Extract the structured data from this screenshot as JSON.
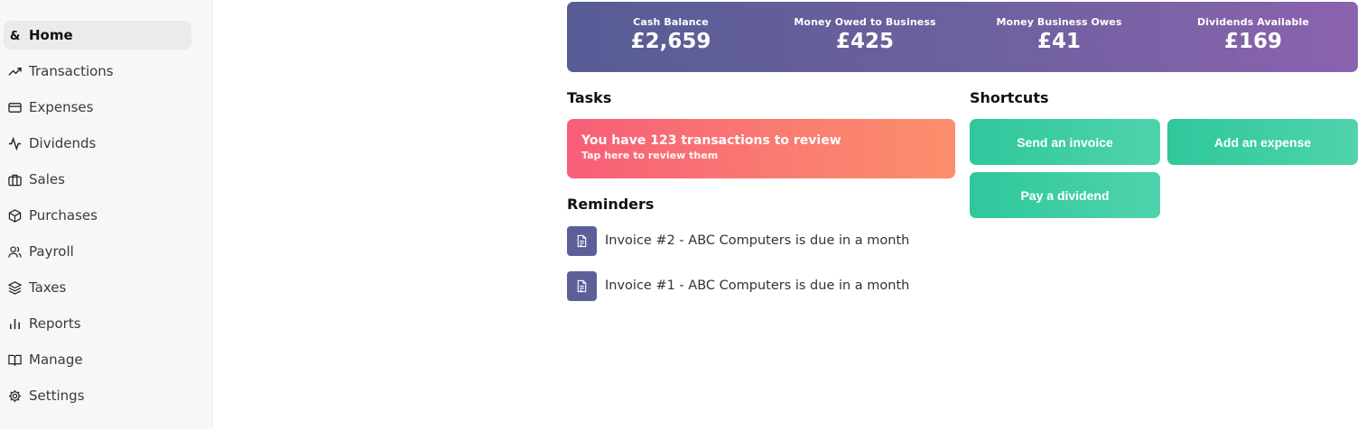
{
  "sidebar": {
    "items": [
      {
        "label": "Home",
        "icon": "ampersand-icon",
        "active": true
      },
      {
        "label": "Transactions",
        "icon": "trending-up-icon"
      },
      {
        "label": "Expenses",
        "icon": "credit-card-icon"
      },
      {
        "label": "Dividends",
        "icon": "activity-icon"
      },
      {
        "label": "Sales",
        "icon": "briefcase-icon"
      },
      {
        "label": "Purchases",
        "icon": "box-icon"
      },
      {
        "label": "Payroll",
        "icon": "users-icon"
      },
      {
        "label": "Taxes",
        "icon": "layers-icon"
      },
      {
        "label": "Reports",
        "icon": "bar-chart-icon"
      },
      {
        "label": "Manage",
        "icon": "book-open-icon"
      },
      {
        "label": "Settings",
        "icon": "gear-icon"
      }
    ]
  },
  "summary": {
    "stats": [
      {
        "label": "Cash Balance",
        "value": "£2,659"
      },
      {
        "label": "Money Owed to Business",
        "value": "£425"
      },
      {
        "label": "Money Business Owes",
        "value": "£41"
      },
      {
        "label": "Dividends Available",
        "value": "£169"
      }
    ]
  },
  "tasks": {
    "title": "Tasks",
    "card_title": "You have 123 transactions to review",
    "card_subtitle": "Tap here to review them"
  },
  "shortcuts": {
    "title": "Shortcuts",
    "send_invoice": "Send an invoice",
    "add_expense": "Add an expense",
    "pay_dividend": "Pay a dividend"
  },
  "reminders": {
    "title": "Reminders",
    "items": [
      "Invoice #2 - ABC Computers is due in a month",
      "Invoice #1 - ABC Computers is due in a month"
    ]
  },
  "colors": {
    "banner_start": "#575c95",
    "banner_end": "#8b62ae",
    "task_start": "#f75f78",
    "task_end": "#fc8e6c",
    "shortcut": "#2fc79b",
    "reminder_icon_bg": "#5d5f99"
  }
}
